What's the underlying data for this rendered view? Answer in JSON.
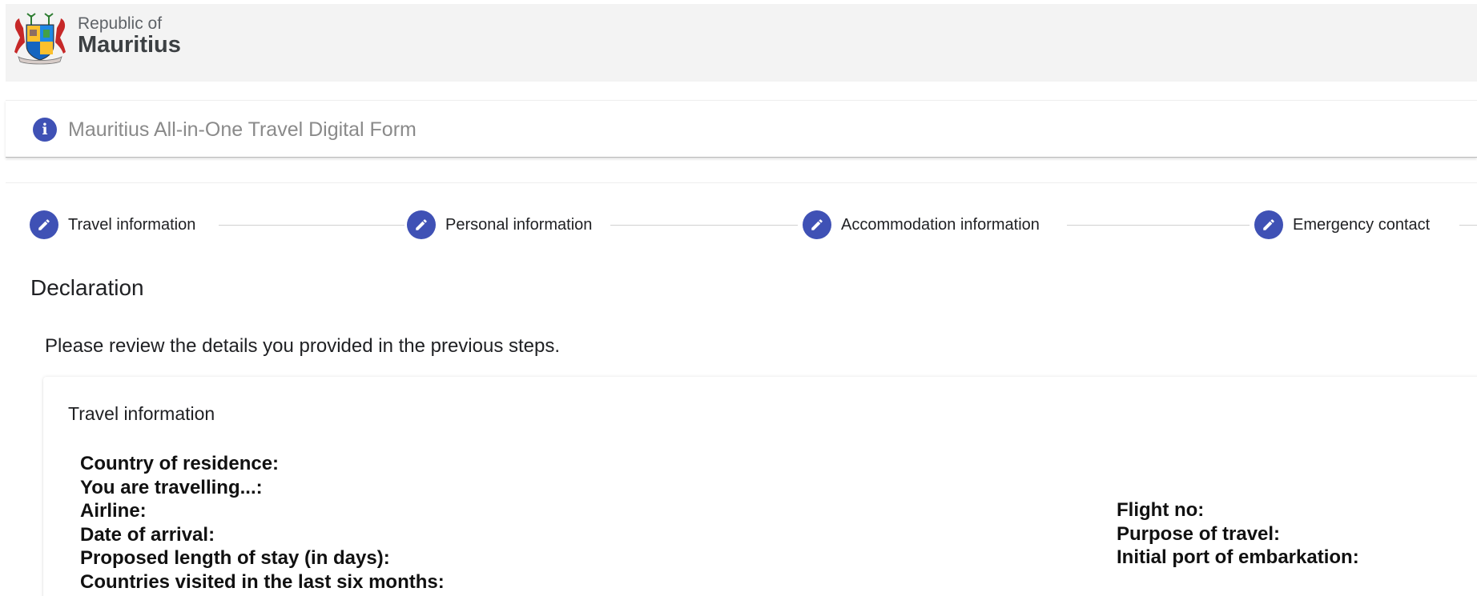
{
  "header": {
    "republic_of": "Republic of",
    "country": "Mauritius"
  },
  "info_bar": {
    "icon": "info-icon",
    "text": "Mauritius All-in-One Travel Digital Form"
  },
  "stepper": {
    "steps": [
      {
        "label": "Travel information",
        "icon": "pencil-icon"
      },
      {
        "label": "Personal information",
        "icon": "pencil-icon"
      },
      {
        "label": "Accommodation information",
        "icon": "pencil-icon"
      },
      {
        "label": "Emergency contact",
        "icon": "pencil-icon"
      }
    ]
  },
  "main": {
    "section_title": "Declaration",
    "review_text": "Please review the details you provided in the previous steps."
  },
  "review_card": {
    "title": "Travel information",
    "left_fields": [
      "Country of residence:",
      "You are travelling...:",
      "Airline:",
      "Date of arrival:",
      "Proposed length of stay (in days):",
      "Countries visited in the last six months:"
    ],
    "right_fields": [
      "Flight no:",
      "Purpose of travel:",
      "Initial port of embarkation:"
    ]
  },
  "colors": {
    "accent": "#3f51b5",
    "header_bg": "#f3f3f3",
    "muted_text": "#8a8a8a"
  }
}
